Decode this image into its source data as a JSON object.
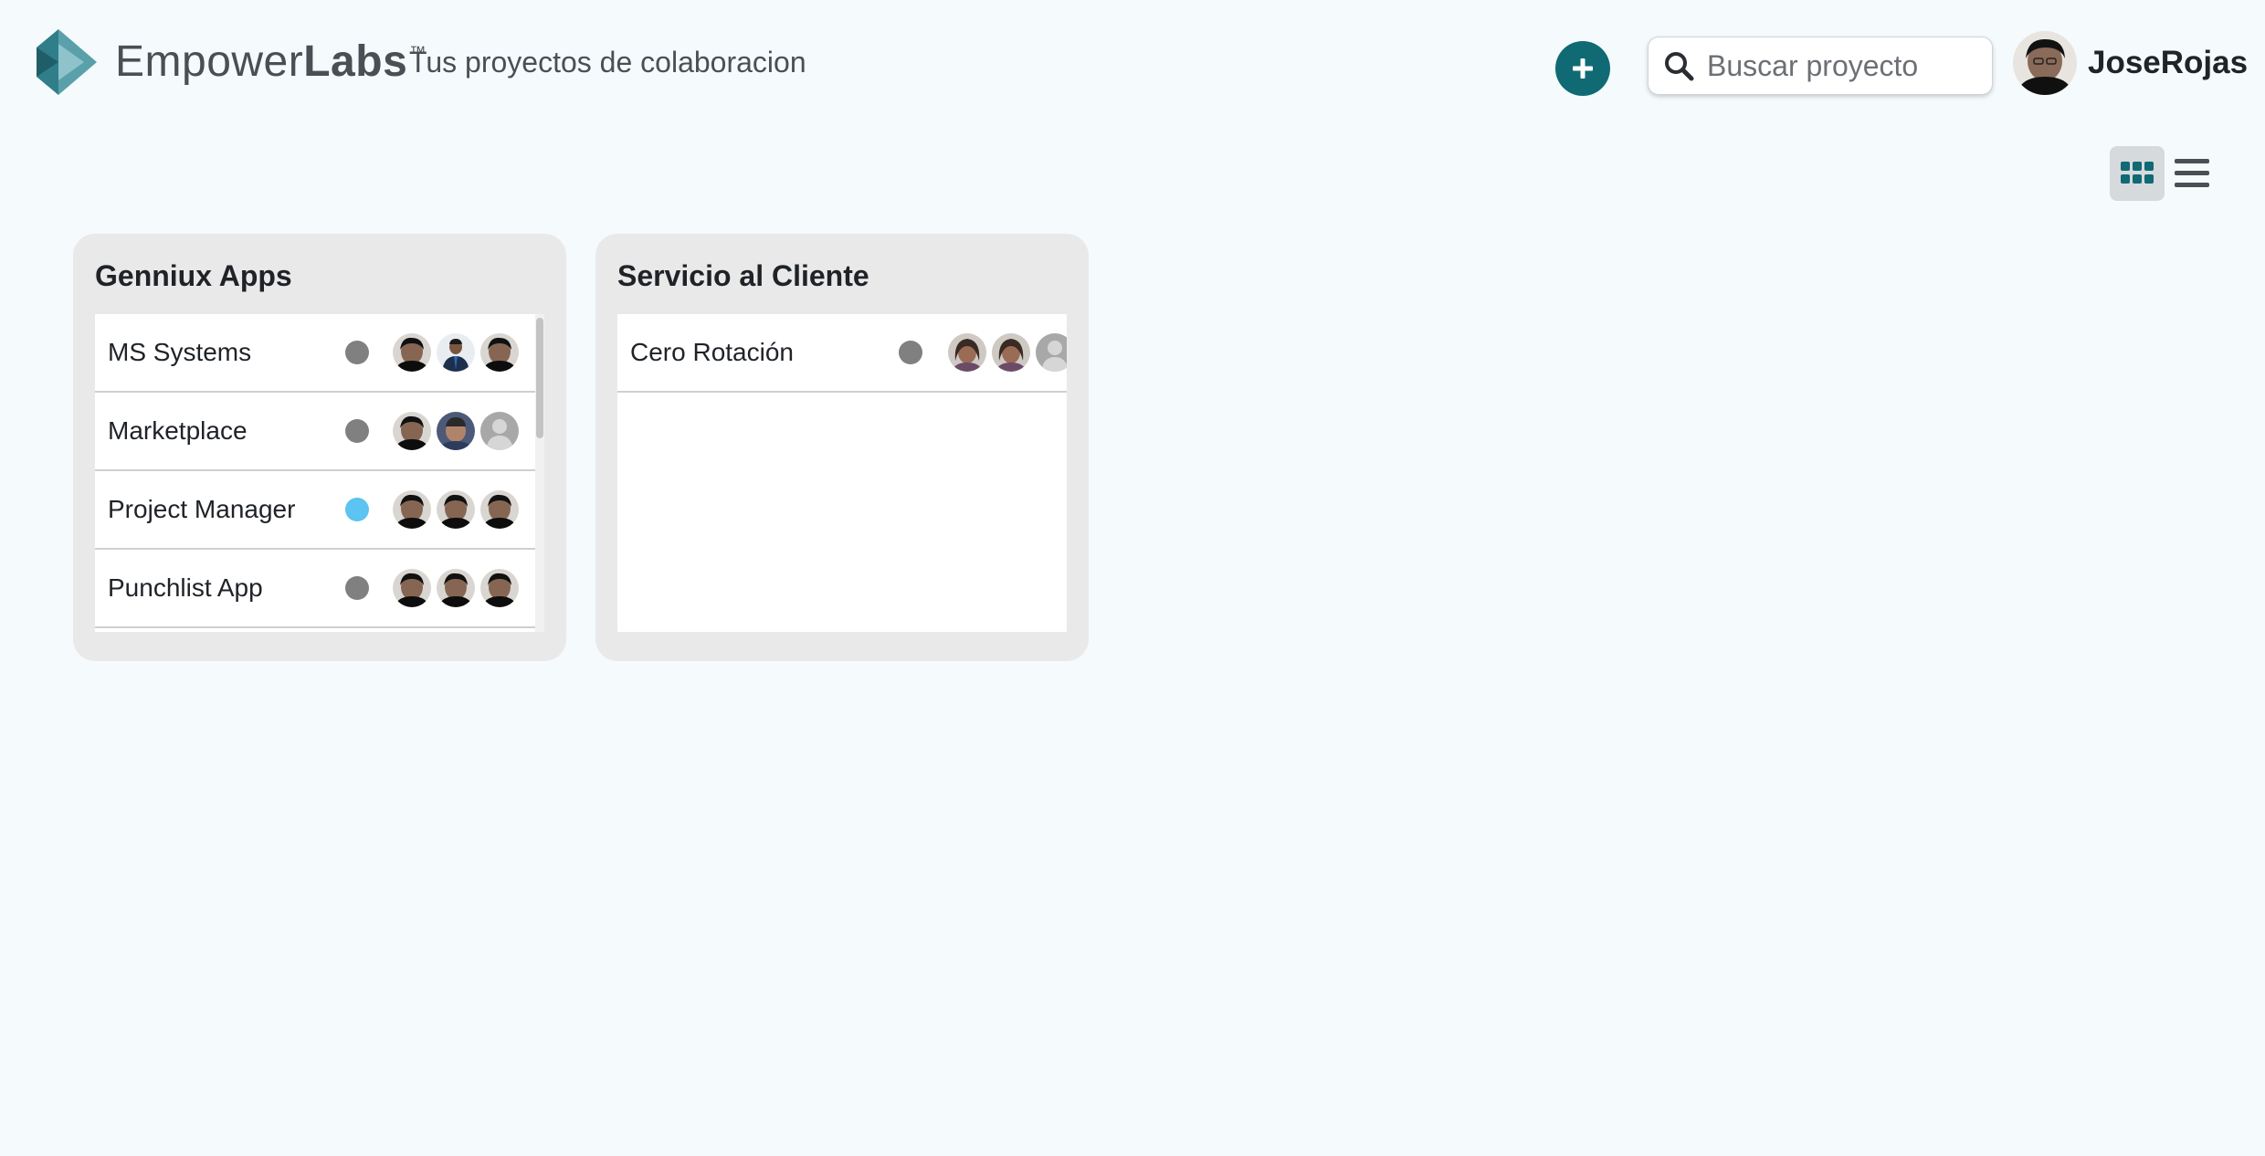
{
  "header": {
    "brand_part1": "Empower",
    "brand_part2": "Labs",
    "brand_tm": "™",
    "tagline": "Tus proyectos de colaboracion",
    "add_icon": "plus-icon",
    "search_placeholder": "Buscar proyecto",
    "search_icon": "search-icon",
    "username": "JoseRojas"
  },
  "view_toggle": {
    "active": "grid",
    "grid_icon": "grid-view-icon",
    "list_icon": "list-view-icon"
  },
  "colors": {
    "accent": "#0f6a74",
    "background": "#f5fafd",
    "card": "#e9e9e9",
    "status_gray": "#808080",
    "status_blue": "#5bc4f0"
  },
  "boards": [
    {
      "title": "Genniux Apps",
      "projects": [
        {
          "name": "MS Systems",
          "status_color": "#808080",
          "members": [
            "dark",
            "suit",
            "dark"
          ]
        },
        {
          "name": "Marketplace",
          "status_color": "#808080",
          "members": [
            "dark",
            "photo",
            "placeholder"
          ]
        },
        {
          "name": "Project Manager",
          "status_color": "#5bc4f0",
          "members": [
            "dark",
            "dark",
            "dark"
          ]
        },
        {
          "name": "Punchlist App",
          "status_color": "#808080",
          "members": [
            "dark",
            "dark",
            "dark"
          ]
        }
      ]
    },
    {
      "title": "Servicio al Cliente",
      "projects": [
        {
          "name": "Cero Rotación",
          "status_color": "#808080",
          "members": [
            "woman",
            "woman",
            "placeholder"
          ]
        }
      ]
    }
  ]
}
